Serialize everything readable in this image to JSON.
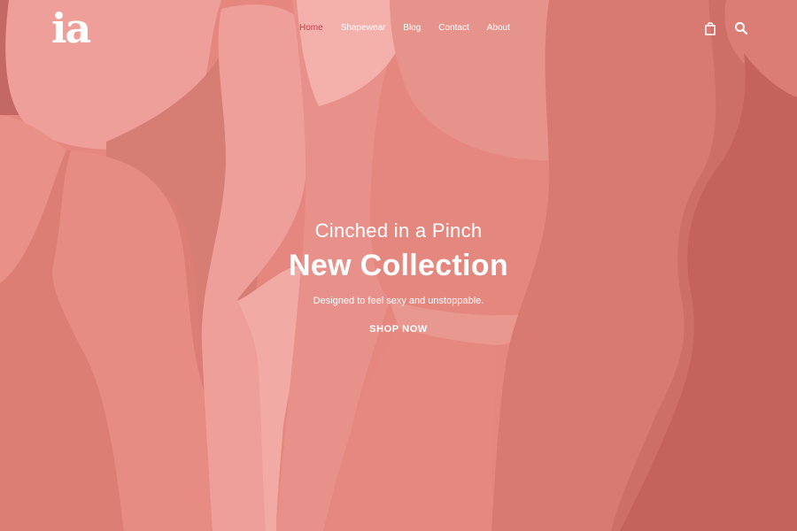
{
  "brand": {
    "logo_text": "ia"
  },
  "nav": {
    "items": [
      {
        "label": "Home",
        "active": true
      },
      {
        "label": "Shapewear",
        "active": false
      },
      {
        "label": "Blog",
        "active": false
      },
      {
        "label": "Contact",
        "active": false
      },
      {
        "label": "About",
        "active": false
      }
    ]
  },
  "header_icons": {
    "cart": "shopping-bag-icon",
    "search": "search-icon"
  },
  "hero": {
    "subtitle": "Cinched in a Pinch",
    "title": "New Collection",
    "tagline": "Designed to feel sexy and unstoppable.",
    "cta_label": "SHOP NOW"
  },
  "colors": {
    "background_base": "#e5877f",
    "active_nav": "#c7414d",
    "text": "#ffffff"
  }
}
